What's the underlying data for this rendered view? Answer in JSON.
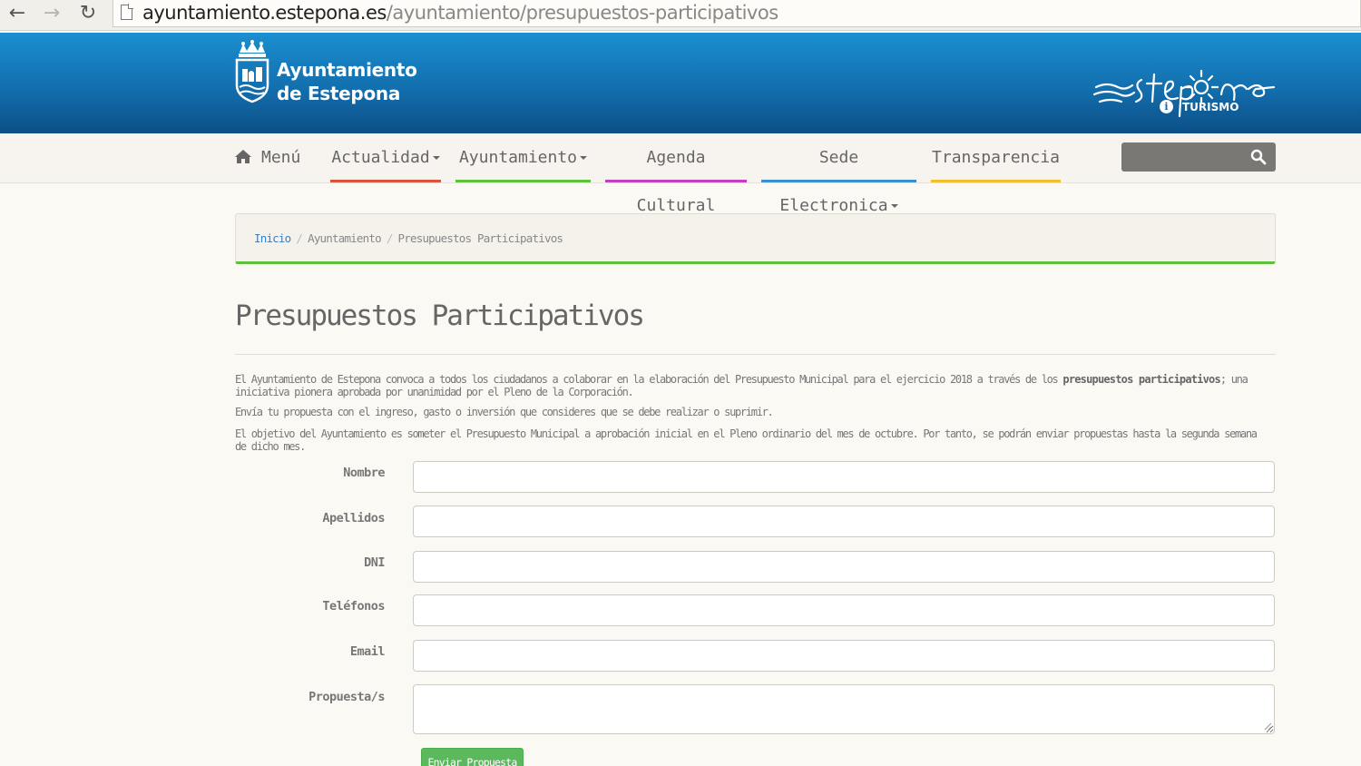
{
  "browser": {
    "back_icon": "back-arrow-icon",
    "forward_icon": "forward-arrow-icon",
    "reload_icon": "reload-icon",
    "url_domain": "ayuntamiento.estepona.es",
    "url_path": "/ayuntamiento/presupuestos-participativos"
  },
  "header": {
    "logo_line1": "Ayuntamiento",
    "logo_line2": "de Estepona",
    "turismo_label": "TURISMO",
    "info_glyph": "i",
    "colors": {
      "header_top": "#1a8fd0",
      "header_bottom": "#0c4f86"
    }
  },
  "nav": {
    "home_label": "Menú",
    "items": [
      {
        "label": "Actualidad",
        "has_dropdown": true,
        "underline": "#d9543a"
      },
      {
        "label": "Ayuntamiento",
        "has_dropdown": true,
        "underline": "#5fbf3f"
      },
      {
        "label": "Agenda Cultural",
        "has_dropdown": false,
        "underline": "#c43fbf"
      },
      {
        "label": "Sede Electronica",
        "has_dropdown": true,
        "underline": "#3a8fd0"
      },
      {
        "label": "Transparencia",
        "has_dropdown": false,
        "underline": "#f0c030"
      }
    ],
    "search_placeholder": ""
  },
  "breadcrumb": {
    "items": [
      "Inicio",
      "Ayuntamiento",
      "Presupuestos Participativos"
    ],
    "separator": "/"
  },
  "page": {
    "title": "Presupuestos Participativos",
    "intro_1_before": "El Ayuntamiento de Estepona convoca a todos los ciudadanos a colaborar en la elaboración del Presupuesto Municipal para el ejercicio 2018 a través de los ",
    "intro_1_bold": "presupuestos participativos",
    "intro_1_after": "; una iniciativa pionera aprobada por unanimidad por el Pleno de la Corporación.",
    "intro_2": "Envía tu propuesta con el ingreso, gasto o inversión que consideres que se debe realizar o suprimir.",
    "intro_3": "El objetivo del Ayuntamiento es someter el Presupuesto Municipal a aprobación inicial en el Pleno ordinario del mes de octubre. Por tanto, se podrán enviar propuestas hasta la segunda semana de dicho mes."
  },
  "form": {
    "nombre_label": "Nombre",
    "nombre_value": "",
    "apellidos_label": "Apellidos",
    "apellidos_value": "",
    "dni_label": "DNI",
    "dni_value": "",
    "telefonos_label": "Teléfonos",
    "telefonos_value": "",
    "email_label": "Email",
    "email_value": "",
    "propuestas_label": "Propuesta/s",
    "propuestas_value": "",
    "submit_label": "Enviar Propuesta"
  }
}
